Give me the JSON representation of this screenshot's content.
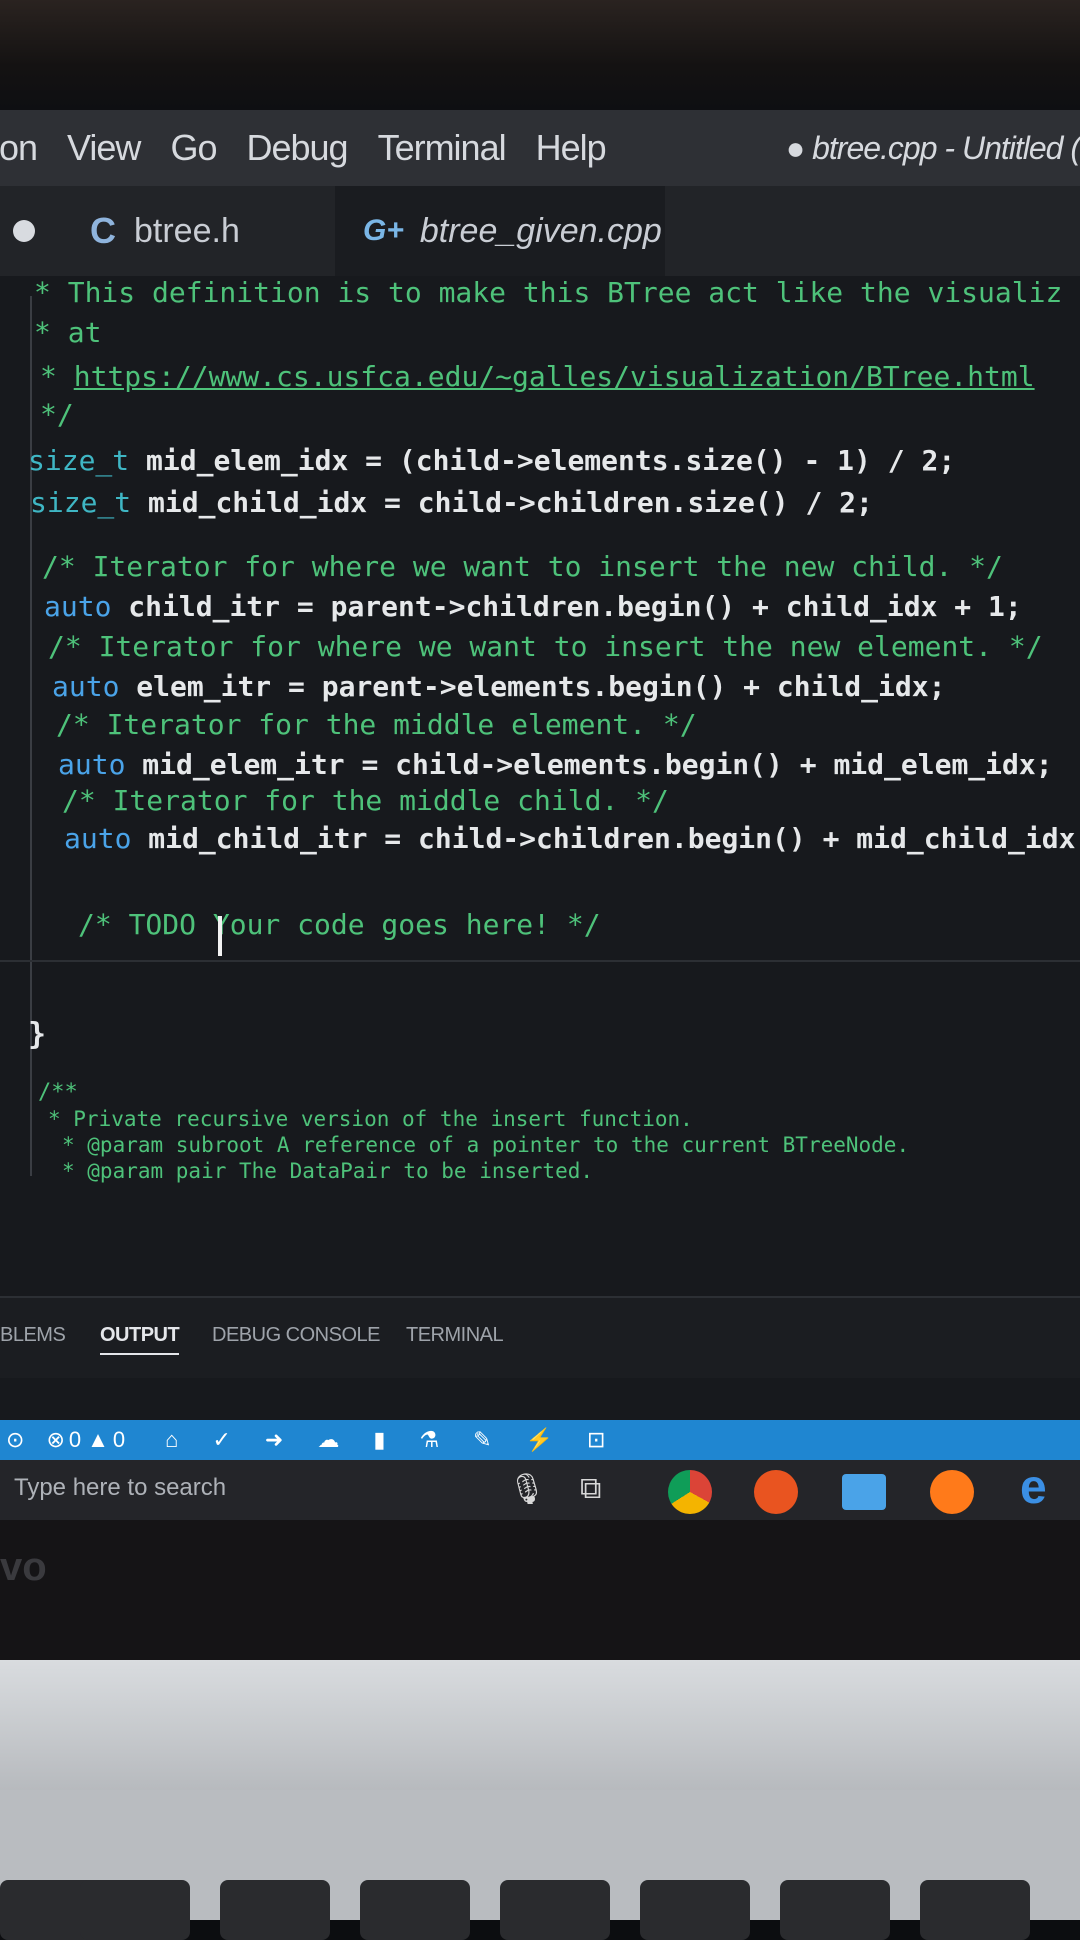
{
  "menu": {
    "items": [
      "ion",
      "View",
      "Go",
      "Debug",
      "Terminal",
      "Help"
    ],
    "window_title": "● btree.cpp - Untitled ("
  },
  "tabs": [
    {
      "icon": "c-file-icon",
      "icon_glyph": "C",
      "label": "btree.h"
    },
    {
      "icon": "cpp-file-icon",
      "icon_glyph": "G+",
      "label": "btree_given.cpp"
    }
  ],
  "code": {
    "comment1": "* This definition is to make this BTree act like the visualiz",
    "comment2": "* at",
    "comment3_star": "* ",
    "comment3_url": "https://www.cs.usfca.edu/~galles/visualization/BTree.html",
    "comment4": "*/",
    "l1_type": "size_t",
    "l1_rest": " mid_elem_idx = (child->elements.size() - 1) / 2;",
    "l2_type": "size_t",
    "l2_rest": " mid_child_idx = child->children.size() / 2;",
    "c1": "/* Iterator for where we want to insert the new child. */",
    "a1_kw": "auto",
    "a1_rest": " child_itr = parent->children.begin() + child_idx + 1;",
    "c2": "/* Iterator for where we want to insert the new element. */",
    "a2_kw": "auto",
    "a2_rest": " elem_itr = parent->elements.begin() + child_idx;",
    "c3": "/* Iterator for the middle element. */",
    "a3_kw": "auto",
    "a3_rest": " mid_elem_itr = child->elements.begin() + mid_elem_idx;",
    "c4": "/* Iterator for the middle child. */",
    "a4_kw": "auto",
    "a4_rest": " mid_child_itr = child->children.begin() + mid_child_idx;",
    "todo": "/* TODO Your code goes here! */",
    "brace": "}",
    "doc1": "/**",
    "doc2": "* Private recursive version of the insert function.",
    "doc3": "* @param subroot A reference of a pointer to the current BTreeNode.",
    "doc4": "* @param pair The DataPair to be inserted."
  },
  "panel_tabs": [
    "BLEMS",
    "OUTPUT",
    "DEBUG CONSOLE",
    "TERMINAL"
  ],
  "status": {
    "errors": "0",
    "warnings": "0"
  },
  "taskbar": {
    "search_placeholder": "Type here to search"
  },
  "brand_fragment": "vo",
  "colors": {
    "status_bar": "#1f86d1",
    "comment": "#4ec27a",
    "keyword": "#4aa3e8"
  }
}
